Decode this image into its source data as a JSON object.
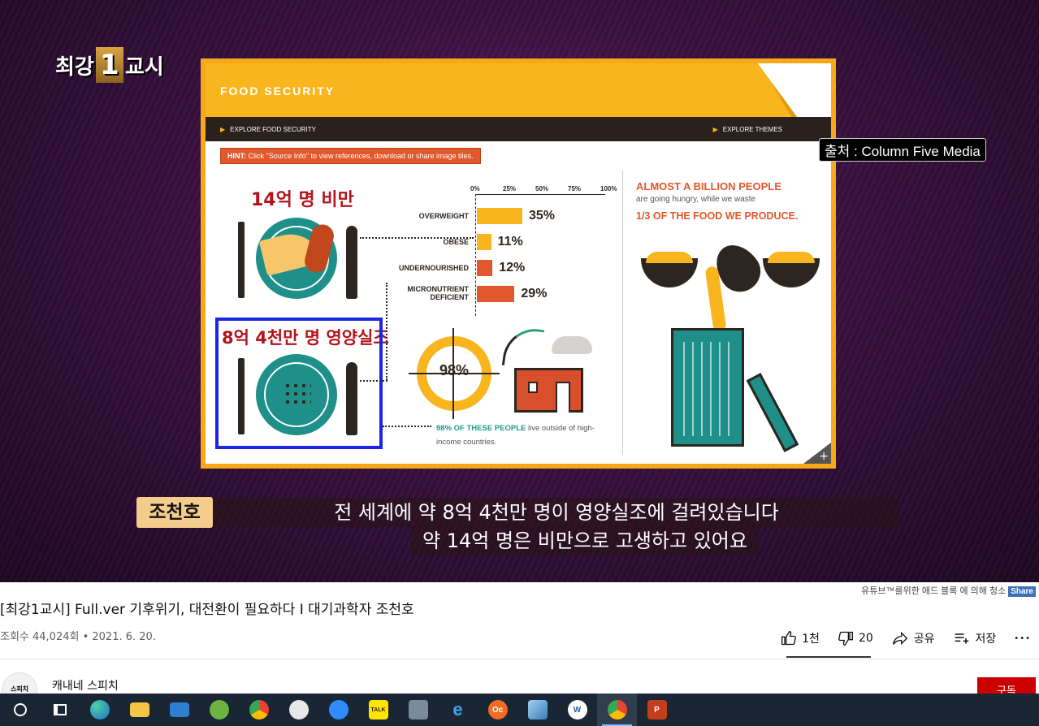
{
  "video": {
    "logo_left": "최강",
    "logo_num": "1",
    "logo_right": "교시",
    "source_tag": "출처 : Column Five Media",
    "speaker": "조천호",
    "caption_line1": "전 세계에 약 8억 4천만 명이 영양실조에 걸려있습니다",
    "caption_line2": "약 14억 명은 비만으로 고생하고 있어요"
  },
  "slide": {
    "header": "FOOD SECURITY",
    "nav_left": "EXPLORE FOOD SECURITY",
    "nav_right": "EXPLORE THEMES",
    "hint_label": "HINT:",
    "hint_text": "Click \"Source Info\" to view references, download or share image tiles.",
    "overlay_obese_kr": "14억 명 비만",
    "overlay_malnutrition_kr": "8억 4천만 명 영양실조",
    "ring_value": "98%",
    "ring_caption_bold": "98% OF THESE PEOPLE",
    "ring_caption_rest": " live outside of high-income countries.",
    "right_h1": "ALMOST A BILLION PEOPLE",
    "right_sub": "are going hungry, while we waste",
    "right_h2": "1/3 OF THE FOOD WE PRODUCE."
  },
  "chart_data": {
    "type": "bar",
    "orientation": "horizontal",
    "ticks": [
      "0%",
      "25%",
      "50%",
      "75%",
      "100%"
    ],
    "xlim": [
      0,
      100
    ],
    "categories": [
      "OVERWEIGHT",
      "OBESE",
      "UNDERNOURISHED",
      "MICRONUTRIENT DEFICIENT"
    ],
    "values": [
      35,
      11,
      12,
      29
    ],
    "value_labels": [
      "35%",
      "11%",
      "12%",
      "29%"
    ],
    "colors": [
      "#f9b51d",
      "#f9b51d",
      "#e2582d",
      "#e2582d"
    ]
  },
  "youtube": {
    "adblock_note": "유튜브™를위한 애드 블록 에 의해 청소",
    "share_badge": "Share",
    "title": "[최강1교시] Full.ver 기후위기, 대전환이 필요하다 I 대기과학자 조천호",
    "meta": "조회수 44,024회 • 2021. 6. 20.",
    "likes": "1천",
    "dislikes": "20",
    "share": "공유",
    "save": "저장",
    "more": "•••",
    "channel": "캐내네 스피치",
    "avatar_text": "스피치",
    "subscribe": "구독"
  },
  "taskbar": {
    "items": [
      "start",
      "task-view",
      "edge",
      "file-explorer",
      "mail",
      "app-green",
      "chrome",
      "app-mascot",
      "zoom",
      "kakaotalk",
      "calculator",
      "internet-explorer",
      "oc-app",
      "notes",
      "w-app",
      "chrome-js",
      "powerpoint"
    ],
    "kakao_label": "TALK",
    "oc_label": "Oc",
    "w_label": "W",
    "ppt_label": "P"
  }
}
